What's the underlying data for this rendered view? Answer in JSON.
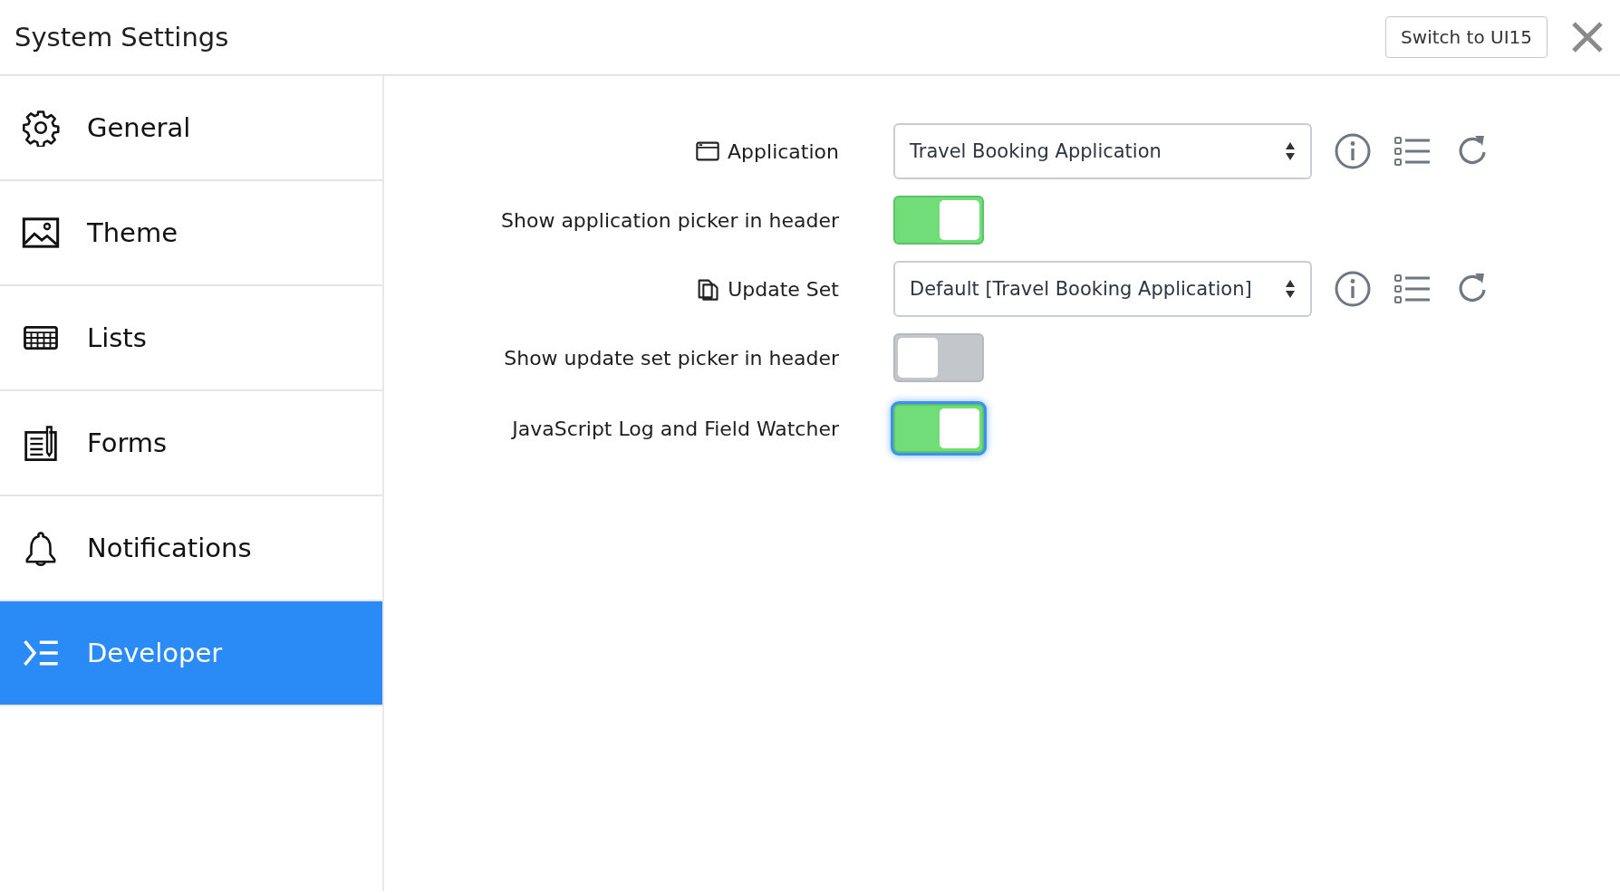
{
  "window": {
    "title": "System Settings"
  },
  "header": {
    "switch_button": "Switch to UI15"
  },
  "sidebar": {
    "items": [
      {
        "label": "General",
        "selected": false
      },
      {
        "label": "Theme",
        "selected": false
      },
      {
        "label": "Lists",
        "selected": false
      },
      {
        "label": "Forms",
        "selected": false
      },
      {
        "label": "Notifications",
        "selected": false
      },
      {
        "label": "Developer",
        "selected": true
      }
    ]
  },
  "settings": [
    {
      "kind": "select",
      "label": "Application",
      "value": "Travel Booking Application"
    },
    {
      "kind": "toggle",
      "label": "Show application picker in header",
      "on": true,
      "focused": false
    },
    {
      "kind": "select",
      "label": "Update Set",
      "value": "Default [Travel Booking Application]"
    },
    {
      "kind": "toggle",
      "label": "Show update set picker in header",
      "on": false,
      "focused": false
    },
    {
      "kind": "toggle",
      "label": "JavaScript Log and Field Watcher",
      "on": true,
      "focused": true
    }
  ]
}
